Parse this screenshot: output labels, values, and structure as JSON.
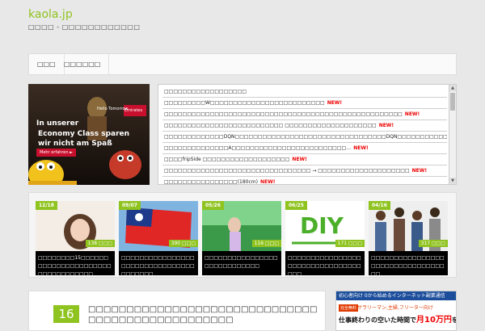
{
  "site": {
    "title": "kaola.jp",
    "description": "□□□□ - □□□□□□□□□□□□"
  },
  "nav": {
    "items": [
      "□□□",
      "□□□□□□"
    ]
  },
  "ad_left": {
    "tagline": "Hello Tomorrow",
    "brand": "Emirates",
    "headline_1": "In unserer",
    "headline_2": "Economy Class sparen",
    "headline_3": "wir nicht am Spaß",
    "cta": "Mehr erfahren ►"
  },
  "news": {
    "new_label": "NEW!",
    "items": [
      {
        "text": "□□□□□□□□□□□□□□□□□□",
        "is_new": false
      },
      {
        "text": "□□□□□□□□□W□□□□□□□□□□□□□□□□□□□□□□□□□",
        "is_new": true
      },
      {
        "text": "□□□□□□□□□□□□□□□□□□□□□□□□□□□□□□□□□□□□□□□□□□□□□□□□□□□□",
        "is_new": true
      },
      {
        "text": "□□□□□□□□□□□□□□□□□□□□□□□□□□ □□□□□□□□□□□□□□□□□□□□",
        "is_new": true
      },
      {
        "text": "□□□□□□□□□□□□□DQN□□□□□□□□□□□□□□□□□□□□□□□□□□□□□□□□□DQN□□□□□□□□□□□□□□□□□□□□□□□□□",
        "is_new": true
      },
      {
        "text": "□□□□□□□□□□□□□□A□□□□□□□□□□□□□□□□□□□□□□□□□…",
        "is_new": true
      },
      {
        "text": "□□□□fripSide □□□□□□□□□□□□□□□□□□□",
        "is_new": true
      },
      {
        "text": "□□□□□□□□□□□□□□□□□□□□□□□□□□□□□□□□ → □□□□□□□□□□□□□□□□□□□□",
        "is_new": true
      },
      {
        "text": "□□□□□□□□□□□□□□□□(180cm)",
        "is_new": true
      },
      {
        "text": "□□□□ □□□□□ □□□□□□□□□□□□□□□□□□□□□□□□□□□□",
        "is_new": true
      }
    ]
  },
  "featured": [
    {
      "date": "12/18",
      "count": "138 □□□",
      "title": "□□□□□□□□15□□□□□□□□□□□□□□□□□□□□□□□□□□□□□□□□□□"
    },
    {
      "date": "09/07",
      "count": "390 □□□",
      "title": "□□□□□□□□□□□□□□□□□□□□□□□□□□□□□□□□□□□□□□□"
    },
    {
      "date": "05/26",
      "count": "116 □□□",
      "title": "□□□□□□□□□□□□□□□□□□□□□□□□□□□□"
    },
    {
      "date": "06/25",
      "count": "171 □□□",
      "title": "□□□□□□□□□□□□□□□□□□□□□□□□□□□□□□□□□□□"
    },
    {
      "date": "04/16",
      "count": "317 □□□",
      "title": "□□□□□□□□□□□□□□□□□□□□□□□□□□□□□□□□□□"
    }
  ],
  "main": {
    "date_day": "16",
    "article_title": "□□□□□□□□□□□□□□□□□□□□□□□□□□□□□□□□□□□□□□□□□□□□□□□□□"
  },
  "side_ad": {
    "header": "初心者向け 0から始めるインターネット副業通信",
    "badge": "完全無料",
    "sub": "サラリーマン,主婦,フリーター向け",
    "main_prefix": "仕事終わりの空いた時間で",
    "main_highlight": "月10万円",
    "main_suffix": "を"
  },
  "colors": {
    "accent": "#8fc31f",
    "new_label": "#e00000"
  }
}
